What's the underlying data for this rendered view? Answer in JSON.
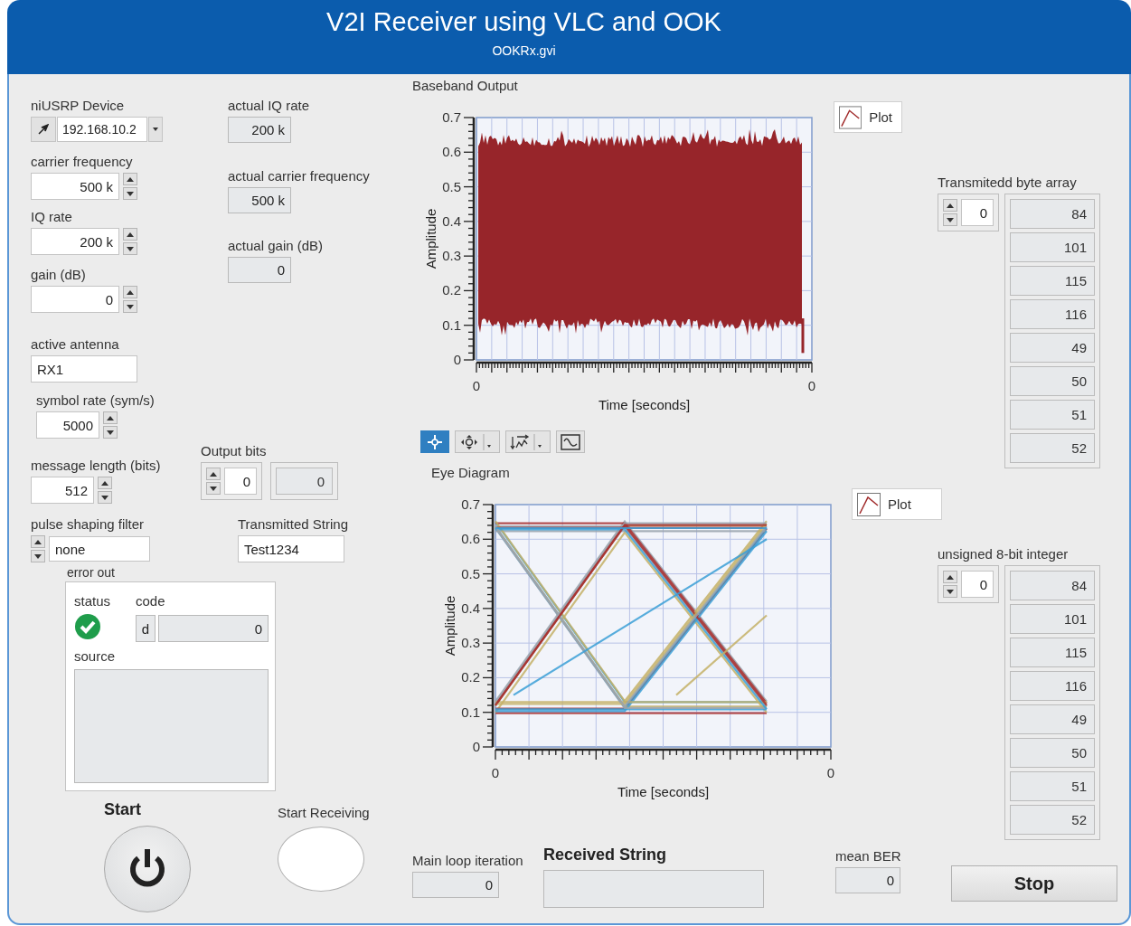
{
  "window": {
    "title": "V2I Receiver using VLC and OOK",
    "subtitle": "OOKRx.gvi"
  },
  "controls": [
    {
      "kind": "resource",
      "label": "niUSRP Device",
      "value": "192.168.10.2"
    },
    {
      "kind": "numeric",
      "label": "carrier frequency",
      "value": "500 k"
    },
    {
      "kind": "numeric",
      "label": "IQ rate",
      "value": "200 k"
    },
    {
      "kind": "numeric",
      "label": "gain (dB)",
      "value": "0"
    },
    {
      "kind": "string",
      "label": "active antenna",
      "value": "RX1"
    },
    {
      "kind": "numeric",
      "label": "symbol rate (sym/s)",
      "value": "5000"
    },
    {
      "kind": "numeric",
      "label": "message length (bits)",
      "value": "512"
    },
    {
      "kind": "ring",
      "label": "pulse shaping filter",
      "value": "none"
    },
    {
      "kind": "indicator",
      "label": "actual IQ rate",
      "value": "200 k"
    },
    {
      "kind": "indicator",
      "label": "actual carrier frequency",
      "value": "500 k"
    },
    {
      "kind": "indicator",
      "label": "actual gain (dB)",
      "value": "0"
    },
    {
      "kind": "array",
      "label": "Output bits",
      "index": "0",
      "values": [
        "0"
      ]
    },
    {
      "kind": "string",
      "label": "Transmitted String",
      "value": "Test1234"
    },
    {
      "kind": "indicator",
      "label": "Main loop iteration",
      "value": "0"
    },
    {
      "kind": "string_indicator",
      "label": "Received String"
    },
    {
      "kind": "indicator",
      "label": "mean BER",
      "value": "0"
    },
    {
      "kind": "array",
      "label": "Transmitedd byte array",
      "index": "0",
      "values": [
        "84",
        "101",
        "115",
        "116",
        "49",
        "50",
        "51",
        "52"
      ]
    },
    {
      "kind": "array",
      "label": "unsigned 8-bit integer",
      "index": "0",
      "values": [
        "84",
        "101",
        "115",
        "116",
        "49",
        "50",
        "51",
        "52"
      ]
    }
  ],
  "error_out": {
    "label": "error out",
    "status_label": "status",
    "status_ok": true,
    "code_label": "code",
    "radix": "d",
    "code": "0",
    "source_label": "source"
  },
  "start": {
    "label": "Start"
  },
  "start_receiving": {
    "label": "Start Receiving",
    "lit": false
  },
  "stop": {
    "label": "Stop"
  },
  "graphs": [
    {
      "kind": "waveform",
      "title": "Baseband Output",
      "ylabel": "Amplitude",
      "xlabel": "Time [seconds]",
      "yticks": [
        "0.7",
        "0.6",
        "0.5",
        "0.4",
        "0.3",
        "0.2",
        "0.1",
        "0"
      ],
      "xticks": [
        "0",
        "0"
      ],
      "legend": "Plot"
    },
    {
      "kind": "eye",
      "title": "Eye Diagram",
      "ylabel": "Amplitude",
      "xlabel": "Time [seconds]",
      "yticks": [
        "0.7",
        "0.6",
        "0.5",
        "0.4",
        "0.3",
        "0.2",
        "0.1",
        "0"
      ],
      "xticks": [
        "0",
        "0"
      ],
      "legend": "Plot"
    }
  ],
  "graph_tools": [
    {
      "kind": "cursor",
      "selected": true,
      "menu": false
    },
    {
      "kind": "pan",
      "selected": false,
      "menu": true
    },
    {
      "kind": "zoom",
      "selected": false,
      "menu": true
    },
    {
      "kind": "fit",
      "selected": false,
      "menu": false
    }
  ]
}
